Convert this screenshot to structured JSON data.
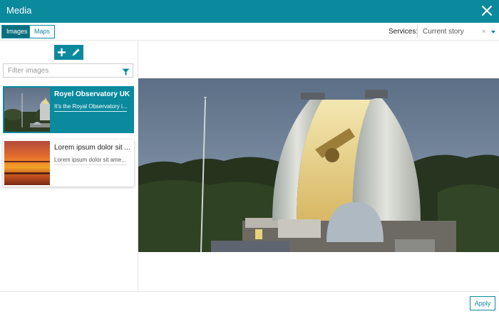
{
  "window": {
    "title": "Media"
  },
  "tabs": [
    {
      "label": "Images",
      "active": true
    },
    {
      "label": "Maps",
      "active": false
    }
  ],
  "services": {
    "label": "Services:",
    "selected": "Current story",
    "clear": "×"
  },
  "sidebar": {
    "actions": [
      {
        "icon": "plus-icon"
      },
      {
        "icon": "pencil-icon"
      }
    ],
    "filter": {
      "placeholder": "Filter images",
      "icon": "funnel-icon"
    },
    "items": [
      {
        "title": "Royel Observatory UK",
        "subtitle": "It's the Royal Observatory i...",
        "selected": true
      },
      {
        "title": "Lorem ipsum dolor sit ...",
        "subtitle": "Lorem ipsum dolor sit ame...",
        "selected": false
      }
    ]
  },
  "footer": {
    "apply_label": "Apply"
  },
  "colors": {
    "accent": "#0b8a9e",
    "accent_dark": "#0b6f7f"
  }
}
